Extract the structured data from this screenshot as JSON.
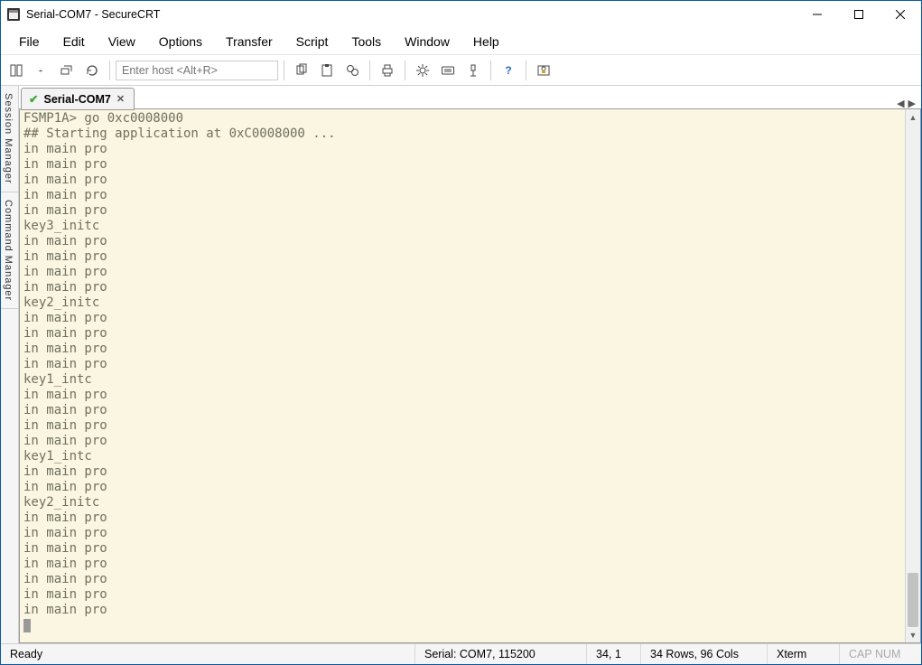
{
  "window": {
    "title": "Serial-COM7 - SecureCRT"
  },
  "menus": {
    "0": "File",
    "1": "Edit",
    "2": "View",
    "3": "Options",
    "4": "Transfer",
    "5": "Script",
    "6": "Tools",
    "7": "Window",
    "8": "Help"
  },
  "toolbar": {
    "host_placeholder": "Enter host <Alt+R>"
  },
  "side_tabs": {
    "session": "Session Manager",
    "command": "Command Manager"
  },
  "tabs": {
    "0": {
      "label": "Serial-COM7"
    }
  },
  "terminal": {
    "lines": [
      "FSMP1A> go 0xc0008000",
      "## Starting application at 0xC0008000 ...",
      "in main pro",
      "in main pro",
      "in main pro",
      "in main pro",
      "in main pro",
      "key3_initc",
      "in main pro",
      "in main pro",
      "in main pro",
      "in main pro",
      "key2_initc",
      "in main pro",
      "in main pro",
      "in main pro",
      "in main pro",
      "key1_intc",
      "in main pro",
      "in main pro",
      "in main pro",
      "in main pro",
      "key1_intc",
      "in main pro",
      "in main pro",
      "key2_initc",
      "in main pro",
      "in main pro",
      "in main pro",
      "in main pro",
      "in main pro",
      "in main pro",
      "in main pro"
    ]
  },
  "status": {
    "ready": "Ready",
    "connection": "Serial: COM7, 115200",
    "cursor": "34,   1",
    "size": "34 Rows, 96 Cols",
    "emu": "Xterm",
    "caps": "CAP NUM"
  }
}
